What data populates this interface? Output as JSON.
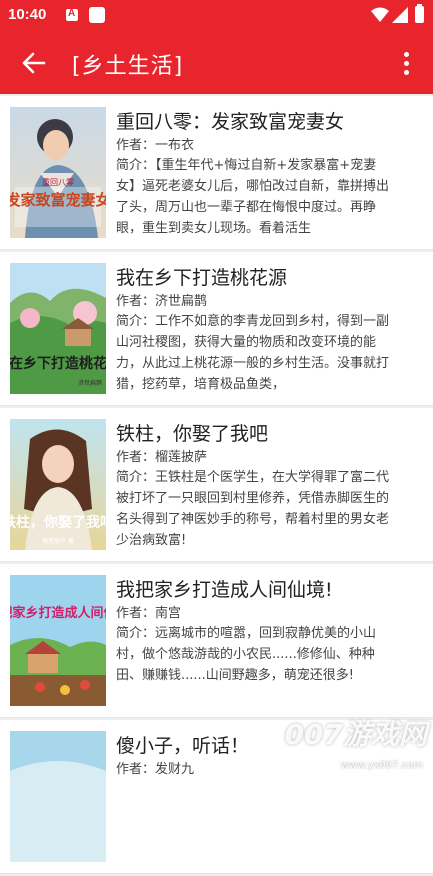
{
  "status": {
    "time": "10:40",
    "icon1": "A"
  },
  "toolbar": {
    "title": "[乡土生活]"
  },
  "labels": {
    "author_prefix": "作者：",
    "intro_prefix": "简介："
  },
  "books": [
    {
      "title": "重回八零：发家致富宠妻女",
      "author": "一布衣",
      "intro": "【重生年代+悔过自新+发家暴富+宠妻女】逼死老婆女儿后，哪怕改过自新，靠拼搏出了头，周万山也一辈子都在悔恨中度过。再睁眼，重生到卖女儿现场。看着活生",
      "cover_text": "发家致富宠妻女",
      "cover_sub": "重回八零"
    },
    {
      "title": "我在乡下打造桃花源",
      "author": "济世扁鹊",
      "intro": "工作不如意的李青龙回到乡村，得到一副山河社稷图，获得大量的物质和改变环境的能力，从此过上桃花源一般的乡村生活。没事就打猎，挖药草，培育极品鱼类，",
      "cover_text": "我在乡下打造桃花源",
      "cover_sub": "济世扁鹊"
    },
    {
      "title": "铁柱，你娶了我吧",
      "author": "榴莲披萨",
      "intro": "王铁柱是个医学生，在大学得罪了富二代被打坏了一只眼回到村里修养，凭借赤脚医生的名头得到了神医妙手的称号，帮着村里的男女老少治病致富!",
      "cover_text": "铁柱，你娶了我吧",
      "cover_sub": "榴莲披萨 著"
    },
    {
      "title": "我把家乡打造成人间仙境!",
      "author": "南宫",
      "intro": "远离城市的喧嚣，回到寂静优美的小山村，做个悠哉游哉的小农民......修修仙、种种田、赚赚钱......山间野趣多，萌宠还很多!",
      "cover_text": "我把家乡打造成人间仙境",
      "cover_sub": ""
    },
    {
      "title": "傻小子，听话！",
      "author": "发财九",
      "intro": "",
      "cover_text": "",
      "cover_sub": ""
    }
  ],
  "watermark": {
    "text": "007游戏网",
    "url": "www.yx007.com"
  }
}
